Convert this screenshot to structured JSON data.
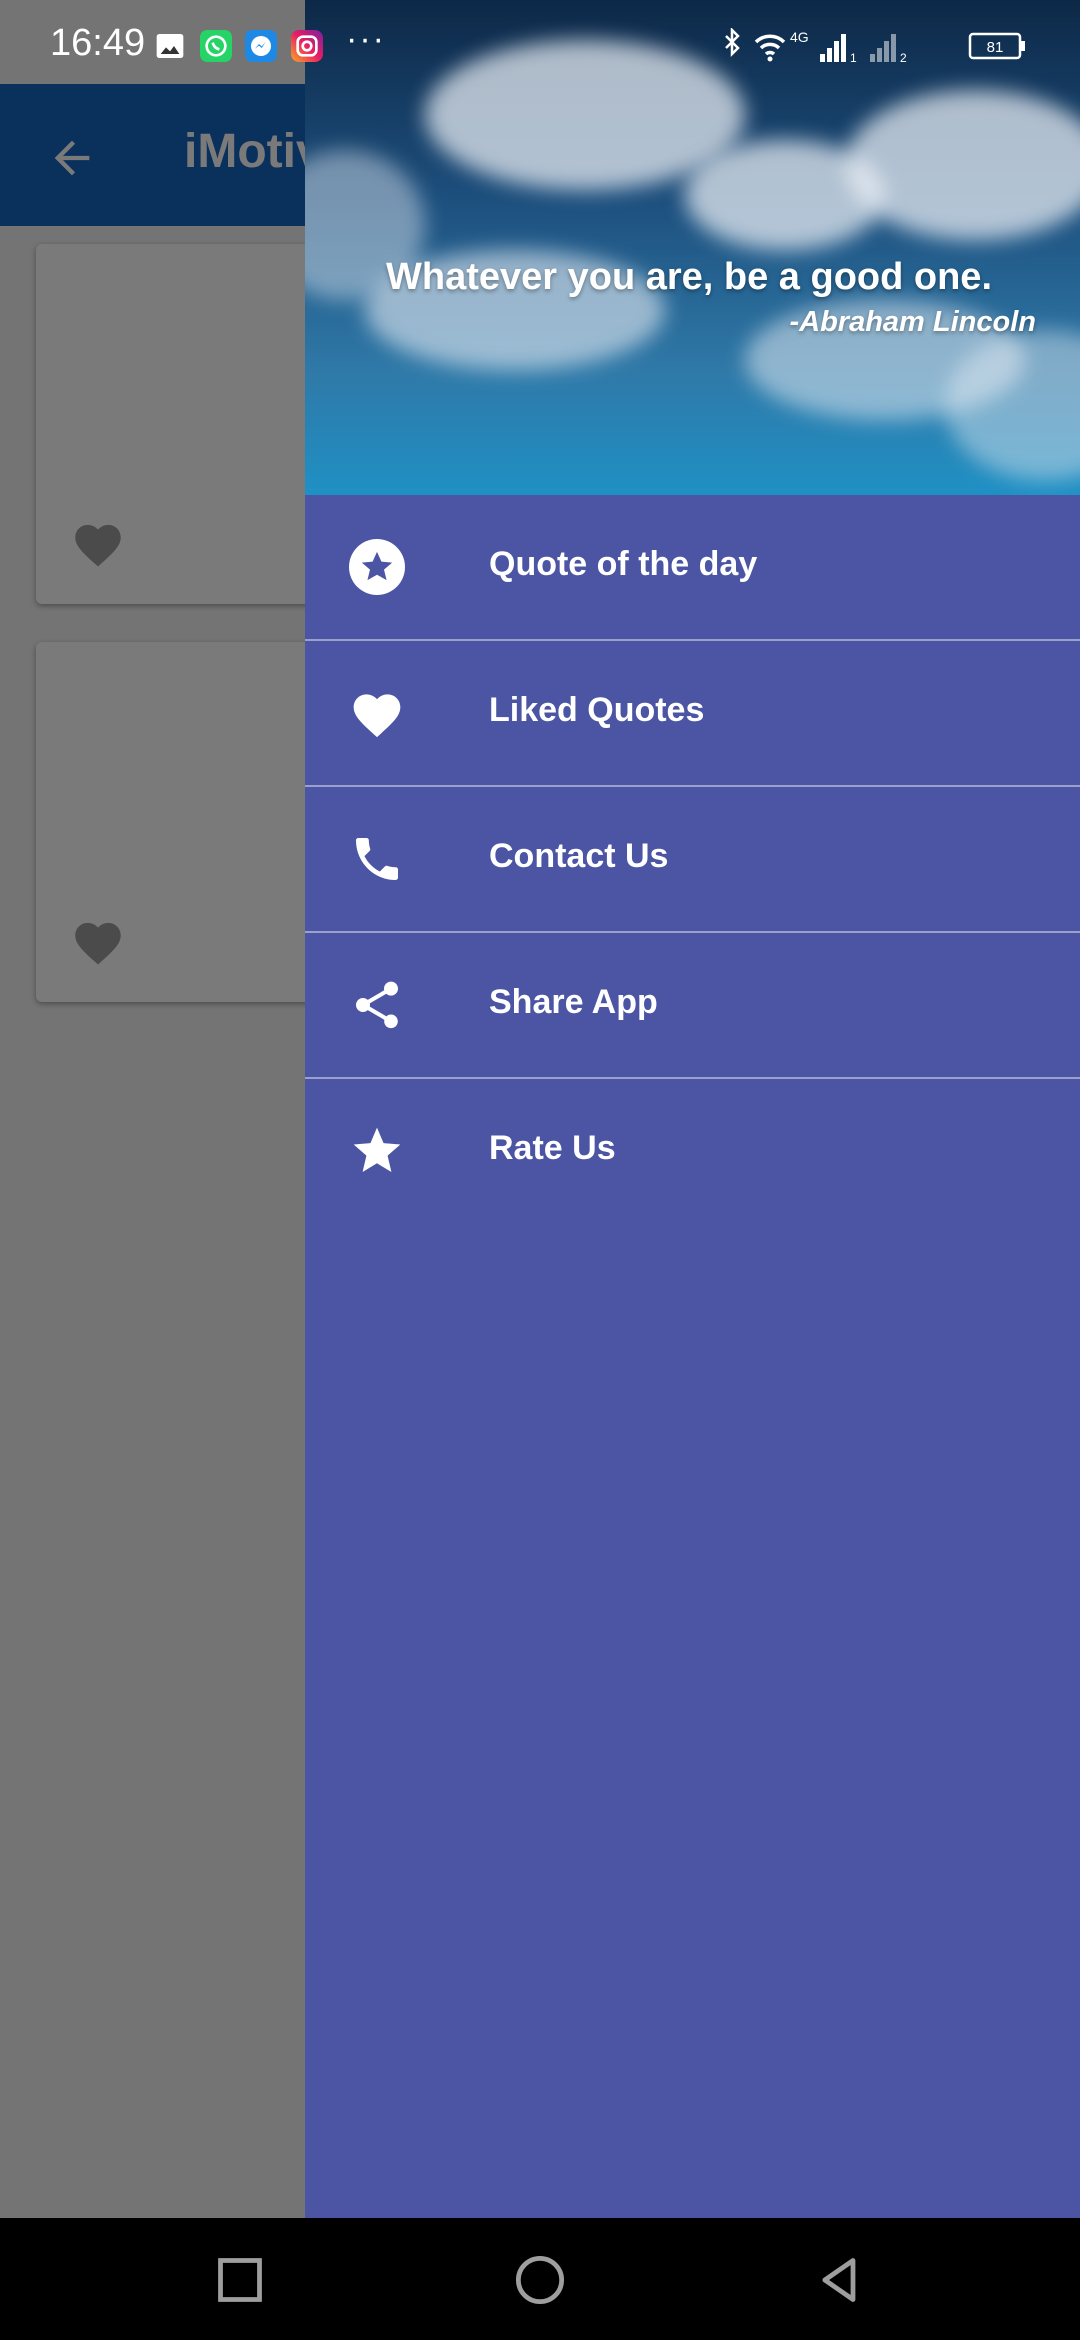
{
  "status_bar": {
    "time": "16:49",
    "overflow": "···",
    "network_type": "4G",
    "sim1": "1",
    "sim2": "2",
    "battery": "81",
    "icons": [
      "gallery-icon",
      "whatsapp-icon",
      "messenger-icon",
      "instagram-icon",
      "bluetooth-icon",
      "wifi-icon",
      "signal-icon",
      "battery-icon"
    ]
  },
  "app": {
    "title": "iMotiv",
    "cards": [
      {
        "liked": false
      },
      {
        "liked": false
      }
    ]
  },
  "drawer": {
    "quote": "Whatever you are, be a good one.",
    "author": "-Abraham Lincoln",
    "items": [
      {
        "label": "Quote of the day",
        "icon": "star-circle-icon"
      },
      {
        "label": "Liked Quotes",
        "icon": "heart-icon"
      },
      {
        "label": "Contact Us",
        "icon": "phone-icon"
      },
      {
        "label": "Share App",
        "icon": "share-icon"
      },
      {
        "label": "Rate Us",
        "icon": "star-icon"
      }
    ]
  },
  "colors": {
    "drawer_bg": "#4b55a3",
    "appbar": "#1565c0",
    "scrim": "#757575"
  }
}
